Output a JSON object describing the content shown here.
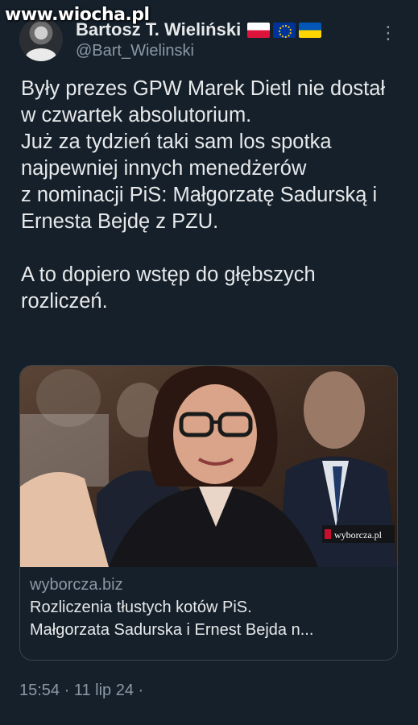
{
  "watermark": "www.wiocha.pl",
  "author": {
    "display_name": "Bartosz T. Wieliński",
    "handle": "@Bart_Wielinski",
    "flags": [
      "flag-poland-icon",
      "flag-eu-icon",
      "flag-ukraine-icon"
    ]
  },
  "tweet": {
    "paragraphs": [
      "Były prezes GPW Marek Dietl nie dostał w czwartek absolutorium.\nJuż za  tydzień taki sam los spotka najpewniej innych menedżerów\nz nominacji  PiS: Małgorzatę Sadurską i Ernesta Bejdę z PZU.",
      "A to dopiero wstęp do  głębszych rozliczeń."
    ],
    "timestamp": "15:54 · 11 lip 24 ·"
  },
  "card": {
    "image_badge": "wyborcza.pl",
    "domain": "wyborcza.biz",
    "title_line1": "Rozliczenia tłustych kotów PiS.",
    "title_line2": "Małgorzata Sadurska i Ernest Bejda n..."
  },
  "colors": {
    "background": "#15202b",
    "text": "#e7e9ea",
    "secondary": "#8b98a5",
    "border": "#38444d",
    "badge_red": "#c8102e"
  }
}
